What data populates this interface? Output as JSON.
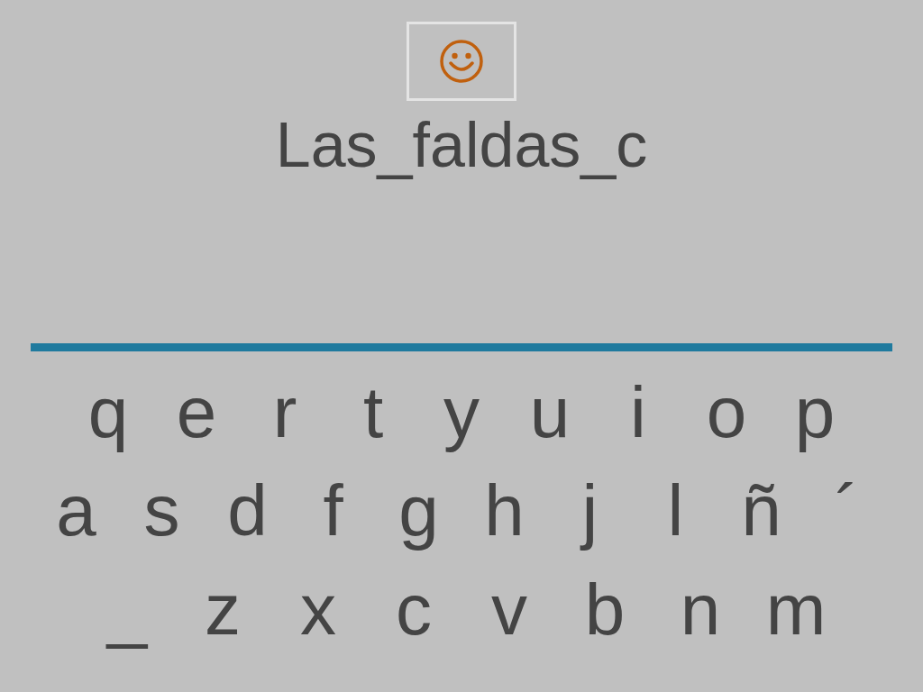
{
  "answer": "Las_faldas_c",
  "keyboard": {
    "rows": [
      [
        "q",
        "e",
        "r",
        "t",
        "y",
        "u",
        "i",
        "o",
        "p"
      ],
      [
        "a",
        "s",
        "d",
        "f",
        "g",
        "h",
        "j",
        "l",
        "ñ",
        "´"
      ],
      [
        "_",
        "z",
        "x",
        "c",
        "v",
        "b",
        "n",
        "m"
      ]
    ]
  }
}
